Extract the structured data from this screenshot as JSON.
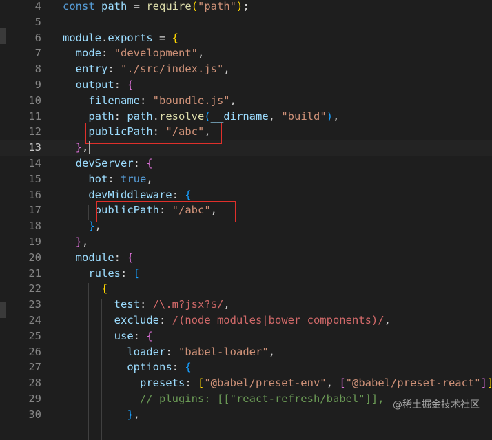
{
  "editor": {
    "lines": [
      {
        "n": "4",
        "tokens": [
          [
            "kw",
            "const"
          ],
          [
            "op",
            " "
          ],
          [
            "var",
            "path"
          ],
          [
            "op",
            " = "
          ],
          [
            "fn",
            "require"
          ],
          [
            "br1",
            "("
          ],
          [
            "str",
            "\"path\""
          ],
          [
            "br1",
            ")"
          ],
          [
            "op",
            ";"
          ]
        ]
      },
      {
        "n": "5",
        "tokens": []
      },
      {
        "n": "6",
        "tokens": [
          [
            "var",
            "module"
          ],
          [
            "op",
            "."
          ],
          [
            "var",
            "exports"
          ],
          [
            "op",
            " = "
          ],
          [
            "br1",
            "{"
          ]
        ]
      },
      {
        "n": "7",
        "tokens": [
          [
            "op",
            "  "
          ],
          [
            "var",
            "mode"
          ],
          [
            "op",
            ": "
          ],
          [
            "str",
            "\"development\""
          ],
          [
            "op",
            ","
          ]
        ]
      },
      {
        "n": "8",
        "tokens": [
          [
            "op",
            "  "
          ],
          [
            "var",
            "entry"
          ],
          [
            "op",
            ": "
          ],
          [
            "str",
            "\"./src/index.js\""
          ],
          [
            "op",
            ","
          ]
        ]
      },
      {
        "n": "9",
        "tokens": [
          [
            "op",
            "  "
          ],
          [
            "var",
            "output"
          ],
          [
            "op",
            ": "
          ],
          [
            "br2",
            "{"
          ]
        ]
      },
      {
        "n": "10",
        "tokens": [
          [
            "op",
            "    "
          ],
          [
            "var",
            "filename"
          ],
          [
            "op",
            ": "
          ],
          [
            "str",
            "\"boundle.js\""
          ],
          [
            "op",
            ","
          ]
        ]
      },
      {
        "n": "11",
        "tokens": [
          [
            "op",
            "    "
          ],
          [
            "var",
            "path"
          ],
          [
            "op",
            ": "
          ],
          [
            "var",
            "path"
          ],
          [
            "op",
            "."
          ],
          [
            "fn",
            "resolve"
          ],
          [
            "br3",
            "("
          ],
          [
            "var",
            "__dirname"
          ],
          [
            "op",
            ", "
          ],
          [
            "str",
            "\"build\""
          ],
          [
            "br3",
            ")"
          ],
          [
            "op",
            ","
          ]
        ]
      },
      {
        "n": "12",
        "tokens": [
          [
            "op",
            "    "
          ],
          [
            "var",
            "publicPath"
          ],
          [
            "op",
            ": "
          ],
          [
            "str",
            "\"/abc\""
          ],
          [
            "op",
            ","
          ]
        ]
      },
      {
        "n": "13",
        "tokens": [
          [
            "op",
            "  "
          ],
          [
            "br2",
            "}"
          ],
          [
            "op",
            ","
          ]
        ]
      },
      {
        "n": "14",
        "tokens": [
          [
            "op",
            "  "
          ],
          [
            "var",
            "devServer"
          ],
          [
            "op",
            ": "
          ],
          [
            "br2",
            "{"
          ]
        ]
      },
      {
        "n": "15",
        "tokens": [
          [
            "op",
            "    "
          ],
          [
            "var",
            "hot"
          ],
          [
            "op",
            ": "
          ],
          [
            "kw",
            "true"
          ],
          [
            "op",
            ","
          ]
        ]
      },
      {
        "n": "16",
        "tokens": [
          [
            "op",
            "    "
          ],
          [
            "var",
            "devMiddleware"
          ],
          [
            "op",
            ": "
          ],
          [
            "br3",
            "{"
          ]
        ]
      },
      {
        "n": "17",
        "tokens": [
          [
            "op",
            "     "
          ],
          [
            "var",
            "publicPath"
          ],
          [
            "op",
            ": "
          ],
          [
            "str",
            "\"/abc\""
          ],
          [
            "op",
            ","
          ]
        ]
      },
      {
        "n": "18",
        "tokens": [
          [
            "op",
            "    "
          ],
          [
            "br3",
            "}"
          ],
          [
            "op",
            ","
          ]
        ]
      },
      {
        "n": "19",
        "tokens": [
          [
            "op",
            "  "
          ],
          [
            "br2",
            "}"
          ],
          [
            "op",
            ","
          ]
        ]
      },
      {
        "n": "20",
        "tokens": [
          [
            "op",
            "  "
          ],
          [
            "var",
            "module"
          ],
          [
            "op",
            ": "
          ],
          [
            "br2",
            "{"
          ]
        ]
      },
      {
        "n": "21",
        "tokens": [
          [
            "op",
            "    "
          ],
          [
            "var",
            "rules"
          ],
          [
            "op",
            ": "
          ],
          [
            "br3",
            "["
          ]
        ]
      },
      {
        "n": "22",
        "tokens": [
          [
            "op",
            "      "
          ],
          [
            "br1",
            "{"
          ]
        ]
      },
      {
        "n": "23",
        "tokens": [
          [
            "op",
            "        "
          ],
          [
            "var",
            "test"
          ],
          [
            "op",
            ": "
          ],
          [
            "rgx",
            "/\\.m?jsx?$/"
          ],
          [
            "op",
            ","
          ]
        ]
      },
      {
        "n": "24",
        "tokens": [
          [
            "op",
            "        "
          ],
          [
            "var",
            "exclude"
          ],
          [
            "op",
            ": "
          ],
          [
            "rgx",
            "/(node_modules|bower_components)/"
          ],
          [
            "op",
            ","
          ]
        ]
      },
      {
        "n": "25",
        "tokens": [
          [
            "op",
            "        "
          ],
          [
            "var",
            "use"
          ],
          [
            "op",
            ": "
          ],
          [
            "br2",
            "{"
          ]
        ]
      },
      {
        "n": "26",
        "tokens": [
          [
            "op",
            "          "
          ],
          [
            "var",
            "loader"
          ],
          [
            "op",
            ": "
          ],
          [
            "str",
            "\"babel-loader\""
          ],
          [
            "op",
            ","
          ]
        ]
      },
      {
        "n": "27",
        "tokens": [
          [
            "op",
            "          "
          ],
          [
            "var",
            "options"
          ],
          [
            "op",
            ": "
          ],
          [
            "br3",
            "{"
          ]
        ]
      },
      {
        "n": "28",
        "tokens": [
          [
            "op",
            "            "
          ],
          [
            "var",
            "presets"
          ],
          [
            "op",
            ": "
          ],
          [
            "br1",
            "["
          ],
          [
            "str",
            "\"@babel/preset-env\""
          ],
          [
            "op",
            ", "
          ],
          [
            "br2",
            "["
          ],
          [
            "str",
            "\"@babel/preset-react\""
          ],
          [
            "br2",
            "]"
          ],
          [
            "br1",
            "]"
          ],
          [
            "op",
            ","
          ]
        ]
      },
      {
        "n": "29",
        "tokens": [
          [
            "op",
            "            "
          ],
          [
            "cmt",
            "// plugins: [[\"react-refresh/babel\"]],"
          ]
        ]
      },
      {
        "n": "30",
        "tokens": [
          [
            "op",
            "          "
          ],
          [
            "br3",
            "}"
          ],
          [
            "op",
            ","
          ]
        ]
      }
    ],
    "active_line": "13",
    "highlighted_lines": [
      "12",
      "17"
    ]
  },
  "watermark": "@稀土掘金技术社区"
}
